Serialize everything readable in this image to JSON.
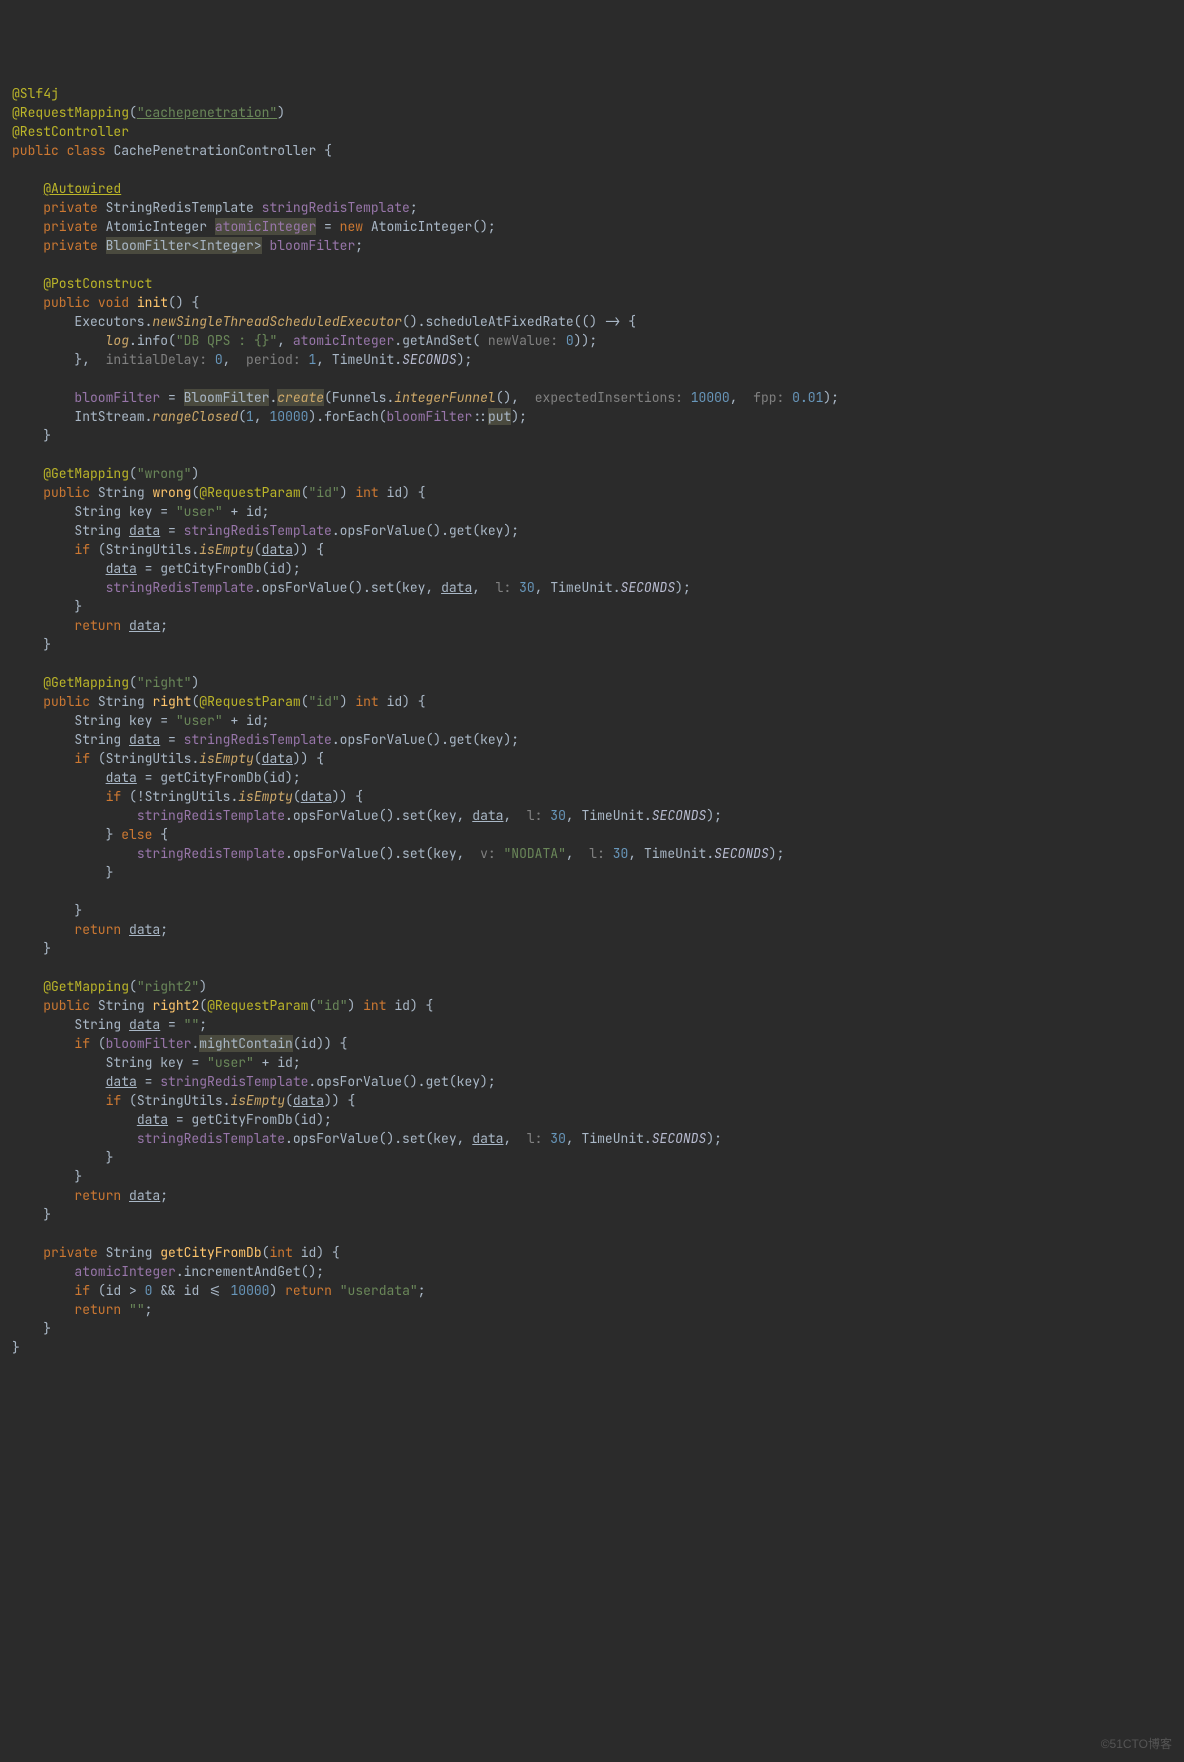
{
  "watermark": "©51CTO博客",
  "code": {
    "anno_slf4j": "@Slf4j",
    "anno_reqmap": "@RequestMapping",
    "reqmap_val": "\"cachepenetration\"",
    "anno_rest": "@RestController",
    "kw_public": "public",
    "kw_class": "class",
    "cls_name": "CachePenetrationController",
    "anno_autowired": "@Autowired",
    "kw_private": "private",
    "type_srt": "StringRedisTemplate",
    "field_srt": "stringRedisTemplate",
    "type_ai": "AtomicInteger",
    "field_ai": "atomicInteger",
    "kw_new": "new",
    "type_bf": "BloomFilter<Integer>",
    "field_bf": "bloomFilter",
    "anno_pc": "@PostConstruct",
    "kw_void": "void",
    "m_init": "init",
    "executors": "Executors",
    "m_nstse": "newSingleThreadScheduledExecutor",
    "m_safr": "scheduleAtFixedRate",
    "log": "log",
    "m_info": "info",
    "str_qps": "\"DB QPS : {}\"",
    "m_gas": "getAndSet",
    "p_newvalue": "newValue:",
    "num_0": "0",
    "p_initdelay": "initialDelay:",
    "p_period": "period:",
    "num_1": "1",
    "type_tu": "TimeUnit",
    "tu_seconds": "SECONDS",
    "type_bfs": "BloomFilter",
    "m_create": "create",
    "type_funnels": "Funnels",
    "m_intfunnel": "integerFunnel",
    "p_expins": "expectedInsertions:",
    "num_10000": "10000",
    "p_fpp": "fpp:",
    "num_001": "0.01",
    "type_intstream": "IntStream",
    "m_rangeclosed": "rangeClosed",
    "m_foreach": "forEach",
    "m_put": "put",
    "anno_get": "@GetMapping",
    "str_wrong": "\"wrong\"",
    "type_string": "String",
    "m_wrong": "wrong",
    "anno_rp": "@RequestParam",
    "str_id": "\"id\"",
    "kw_int": "int",
    "p_id": "id",
    "var_key": "key",
    "str_user": "\"user\"",
    "var_data": "data",
    "m_ofv": "opsForValue",
    "m_get": "get",
    "m_set": "set",
    "kw_if": "if",
    "type_su": "StringUtils",
    "m_isempty": "isEmpty",
    "m_gcfd": "getCityFromDb",
    "p_l": "l:",
    "num_30": "30",
    "kw_return": "return",
    "str_right": "\"right\"",
    "m_right": "right",
    "kw_else": "else",
    "p_v": "v:",
    "str_nodata": "\"NODATA\"",
    "str_right2": "\"right2\"",
    "m_right2": "right2",
    "str_empty": "\"\"",
    "m_mightcontain": "mightContain",
    "m_iag": "incrementAndGet",
    "str_userdata": "\"userdata\"",
    "cond_idgt": "id > ",
    "cond_idle": " && id <= "
  }
}
